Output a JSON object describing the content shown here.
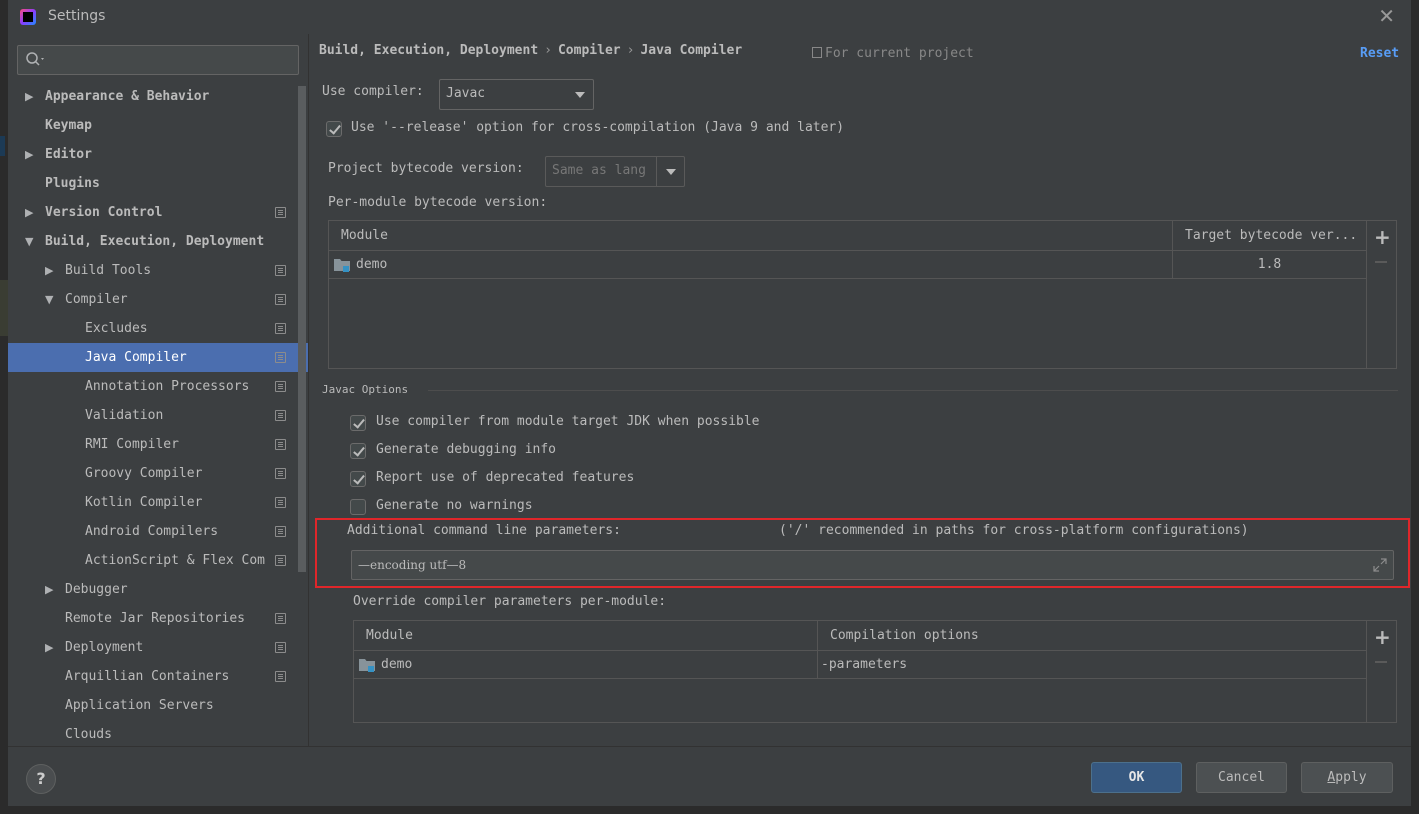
{
  "window": {
    "title": "Settings"
  },
  "sidebar": {
    "search": {
      "placeholder": "",
      "value": ""
    },
    "items": [
      {
        "label": "Appearance & Behavior",
        "arrow": "▶",
        "level": 0,
        "bold": true,
        "project": false
      },
      {
        "label": "Keymap",
        "arrow": "",
        "level": 0,
        "bold": true,
        "project": false
      },
      {
        "label": "Editor",
        "arrow": "▶",
        "level": 0,
        "bold": true,
        "project": false
      },
      {
        "label": "Plugins",
        "arrow": "",
        "level": 0,
        "bold": true,
        "project": false
      },
      {
        "label": "Version Control",
        "arrow": "▶",
        "level": 0,
        "bold": true,
        "project": true
      },
      {
        "label": "Build, Execution, Deployment",
        "arrow": "▼",
        "level": 0,
        "bold": true,
        "project": false
      },
      {
        "label": "Build Tools",
        "arrow": "▶",
        "level": 1,
        "bold": false,
        "project": true
      },
      {
        "label": "Compiler",
        "arrow": "▼",
        "level": 1,
        "bold": false,
        "project": true
      },
      {
        "label": "Excludes",
        "arrow": "",
        "level": 2,
        "bold": false,
        "project": true
      },
      {
        "label": "Java Compiler",
        "arrow": "",
        "level": 2,
        "bold": false,
        "project": true,
        "selected": true
      },
      {
        "label": "Annotation Processors",
        "arrow": "",
        "level": 2,
        "bold": false,
        "project": true
      },
      {
        "label": "Validation",
        "arrow": "",
        "level": 2,
        "bold": false,
        "project": true
      },
      {
        "label": "RMI Compiler",
        "arrow": "",
        "level": 2,
        "bold": false,
        "project": true
      },
      {
        "label": "Groovy Compiler",
        "arrow": "",
        "level": 2,
        "bold": false,
        "project": true
      },
      {
        "label": "Kotlin Compiler",
        "arrow": "",
        "level": 2,
        "bold": false,
        "project": true
      },
      {
        "label": "Android Compilers",
        "arrow": "",
        "level": 2,
        "bold": false,
        "project": true
      },
      {
        "label": "ActionScript & Flex Com",
        "arrow": "",
        "level": 2,
        "bold": false,
        "project": true
      },
      {
        "label": "Debugger",
        "arrow": "▶",
        "level": 1,
        "bold": false,
        "project": false
      },
      {
        "label": "Remote Jar Repositories",
        "arrow": "",
        "level": 1,
        "bold": false,
        "project": true
      },
      {
        "label": "Deployment",
        "arrow": "▶",
        "level": 1,
        "bold": false,
        "project": true
      },
      {
        "label": "Arquillian Containers",
        "arrow": "",
        "level": 1,
        "bold": false,
        "project": true
      },
      {
        "label": "Application Servers",
        "arrow": "",
        "level": 1,
        "bold": false,
        "project": false
      },
      {
        "label": "Clouds",
        "arrow": "",
        "level": 1,
        "bold": false,
        "project": false
      }
    ]
  },
  "breadcrumb": [
    "Build, Execution, Deployment",
    "Compiler",
    "Java Compiler"
  ],
  "breadcrumb_sep": "›",
  "scope_label": "For current project",
  "reset_label": "Reset",
  "compiler": {
    "use_compiler_label": "Use compiler:",
    "use_compiler_value": "Javac",
    "release_option_label": "Use '--release' option for cross-compilation (Java 9 and later)",
    "release_option_checked": true,
    "project_bytecode_label": "Project bytecode version:",
    "project_bytecode_value": "Same as lang",
    "per_module_label": "Per-module bytecode version:",
    "per_module_table": {
      "columns": [
        "Module",
        "Target bytecode ver..."
      ],
      "rows": [
        {
          "module": "demo",
          "target": "1.8"
        }
      ]
    }
  },
  "javac": {
    "section_title": "Javac Options",
    "options": [
      {
        "label": "Use compiler from module target JDK when possible",
        "checked": true
      },
      {
        "label": "Generate debugging info",
        "checked": true
      },
      {
        "label": "Report use of deprecated features",
        "checked": true
      },
      {
        "label": "Generate no warnings",
        "checked": false
      }
    ],
    "additional_params_label": "Additional command line parameters:",
    "additional_params_hint": "('/' recommended in paths for cross-platform configurations)",
    "additional_params_value": "—encoding utf—8",
    "override_label": "Override compiler parameters per-module:",
    "override_table": {
      "columns": [
        "Module",
        "Compilation options"
      ],
      "rows": [
        {
          "module": "demo",
          "options": "-parameters"
        }
      ]
    }
  },
  "buttons": {
    "help": "?",
    "ok": "OK",
    "cancel": "Cancel",
    "apply_mnemonic": "A",
    "apply_rest": "pply"
  },
  "colors": {
    "selection": "#4b6eaf",
    "link": "#589df6",
    "highlight_box": "#e0262a",
    "primary_button": "#365880"
  }
}
